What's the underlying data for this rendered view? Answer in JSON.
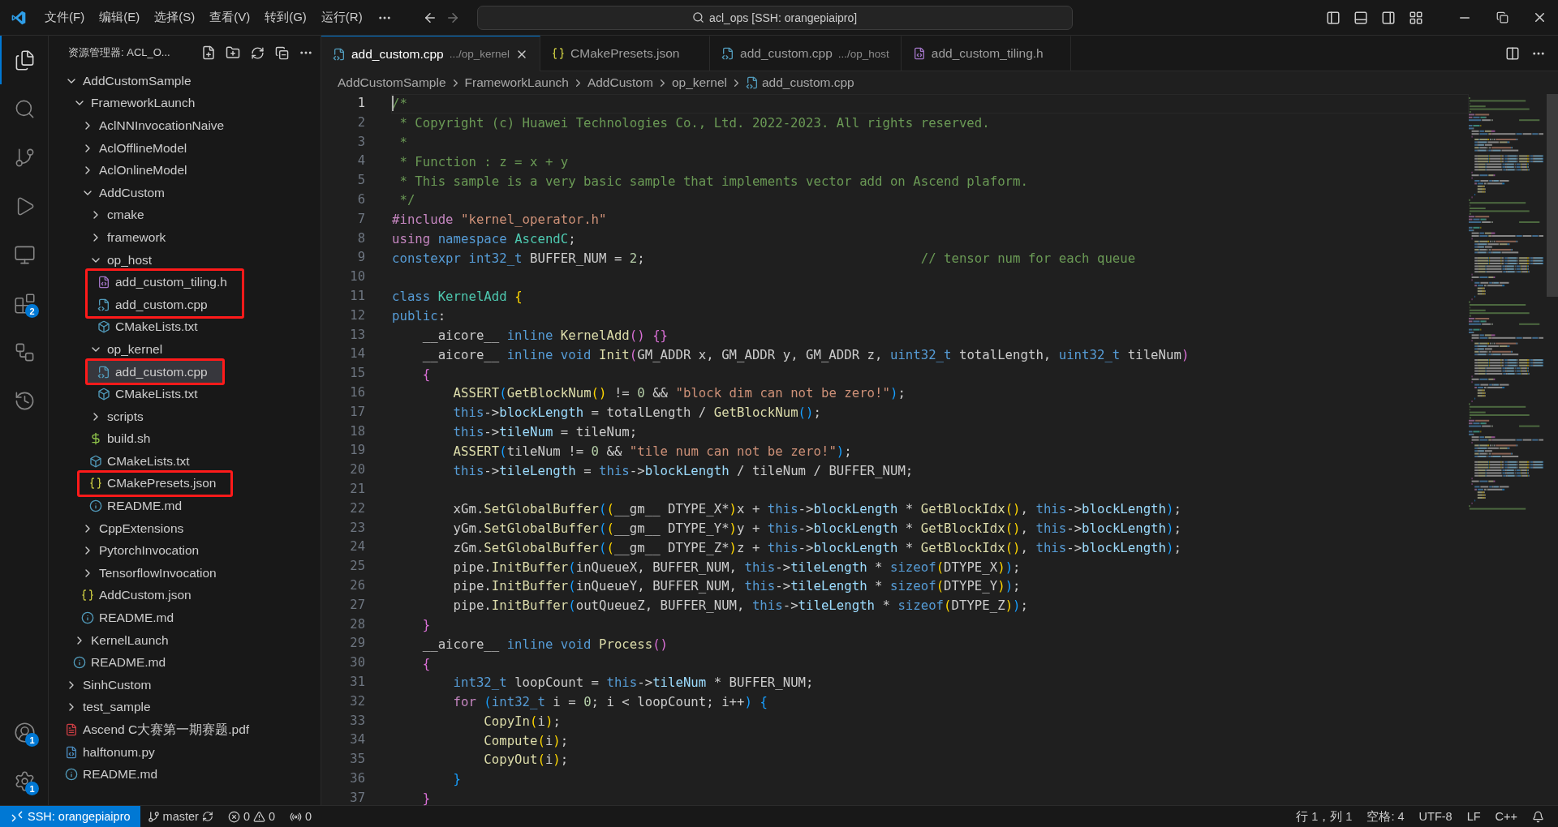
{
  "title_bar": {
    "menus": [
      "文件(F)",
      "编辑(E)",
      "选择(S)",
      "查看(V)",
      "转到(G)",
      "运行(R)"
    ],
    "command_center": "acl_ops [SSH: orangepiaipro]"
  },
  "activity_bar": {
    "top": [
      {
        "kind": "explorer",
        "selected": true
      },
      {
        "kind": "search",
        "selected": false
      },
      {
        "kind": "source_control",
        "selected": false
      },
      {
        "kind": "run",
        "selected": false
      },
      {
        "kind": "remote",
        "selected": false
      },
      {
        "kind": "extensions",
        "selected": false,
        "badge": "2"
      },
      {
        "kind": "graph",
        "selected": false
      },
      {
        "kind": "timeline",
        "selected": false
      }
    ],
    "bottom": [
      {
        "kind": "accounts",
        "selected": false,
        "badge": "1"
      },
      {
        "kind": "settings",
        "selected": false,
        "badge": "1"
      }
    ]
  },
  "explorer": {
    "title": "资源管理器: ACL_O...",
    "tree": [
      {
        "label": "AddCustomSample",
        "kind": "folder",
        "expanded": true,
        "selected": false,
        "marked": false,
        "children": [
          {
            "label": "FrameworkLaunch",
            "kind": "folder",
            "expanded": true,
            "selected": false,
            "marked": false,
            "children": [
              {
                "label": "AclNNInvocationNaive",
                "kind": "folder",
                "expanded": false,
                "selected": false,
                "marked": false
              },
              {
                "label": "AclOfflineModel",
                "kind": "folder",
                "expanded": false,
                "selected": false,
                "marked": false
              },
              {
                "label": "AclOnlineModel",
                "kind": "folder",
                "expanded": false,
                "selected": false,
                "marked": false
              },
              {
                "label": "AddCustom",
                "kind": "folder",
                "expanded": true,
                "selected": false,
                "marked": false,
                "children": [
                  {
                    "label": "cmake",
                    "kind": "folder",
                    "expanded": false,
                    "selected": false,
                    "marked": false
                  },
                  {
                    "label": "framework",
                    "kind": "folder",
                    "expanded": false,
                    "selected": false,
                    "marked": false
                  },
                  {
                    "label": "op_host",
                    "kind": "folder",
                    "expanded": true,
                    "selected": false,
                    "marked": false,
                    "children": [
                      {
                        "label": "add_custom_tiling.h",
                        "kind": "c_header",
                        "selected": false,
                        "marked": true
                      },
                      {
                        "label": "add_custom.cpp",
                        "kind": "cpp",
                        "selected": false,
                        "marked": true
                      },
                      {
                        "label": "CMakeLists.txt",
                        "kind": "cmake",
                        "selected": false,
                        "marked": false
                      }
                    ]
                  },
                  {
                    "label": "op_kernel",
                    "kind": "folder",
                    "expanded": true,
                    "selected": false,
                    "marked": false,
                    "children": [
                      {
                        "label": "add_custom.cpp",
                        "kind": "cpp",
                        "selected": true,
                        "marked": true
                      },
                      {
                        "label": "CMakeLists.txt",
                        "kind": "cmake",
                        "selected": false,
                        "marked": false
                      }
                    ]
                  },
                  {
                    "label": "scripts",
                    "kind": "folder",
                    "expanded": false,
                    "selected": false,
                    "marked": false
                  },
                  {
                    "label": "build.sh",
                    "kind": "shell",
                    "selected": false,
                    "marked": false
                  },
                  {
                    "label": "CMakeLists.txt",
                    "kind": "cmake",
                    "selected": false,
                    "marked": false
                  },
                  {
                    "label": "CMakePresets.json",
                    "kind": "json",
                    "selected": false,
                    "marked": true
                  },
                  {
                    "label": "README.md",
                    "kind": "markdown",
                    "selected": false,
                    "marked": false
                  }
                ]
              },
              {
                "label": "CppExtensions",
                "kind": "folder",
                "expanded": false,
                "selected": false,
                "marked": false
              },
              {
                "label": "PytorchInvocation",
                "kind": "folder",
                "expanded": false,
                "selected": false,
                "marked": false
              },
              {
                "label": "TensorflowInvocation",
                "kind": "folder",
                "expanded": false,
                "selected": false,
                "marked": false
              },
              {
                "label": "AddCustom.json",
                "kind": "json",
                "selected": false,
                "marked": false
              },
              {
                "label": "README.md",
                "kind": "markdown",
                "selected": false,
                "marked": false
              }
            ]
          },
          {
            "label": "KernelLaunch",
            "kind": "folder",
            "expanded": false,
            "selected": false,
            "marked": false
          },
          {
            "label": "README.md",
            "kind": "markdown",
            "selected": false,
            "marked": false
          }
        ]
      },
      {
        "label": "SinhCustom",
        "kind": "folder",
        "expanded": false,
        "selected": false,
        "marked": false
      },
      {
        "label": "test_sample",
        "kind": "folder",
        "expanded": false,
        "selected": false,
        "marked": false
      },
      {
        "label": "Ascend C大赛第一期赛题.pdf",
        "kind": "pdf",
        "selected": false,
        "marked": false
      },
      {
        "label": "halftonum.py",
        "kind": "python",
        "selected": false,
        "marked": false
      },
      {
        "label": "README.md",
        "kind": "markdown",
        "selected": false,
        "marked": false
      }
    ]
  },
  "tabs": [
    {
      "label": "add_custom.cpp",
      "description": ".../op_kernel",
      "kind": "cpp",
      "selected": true
    },
    {
      "label": "CMakePresets.json",
      "kind": "json",
      "selected": false
    },
    {
      "label": "add_custom.cpp",
      "description": ".../op_host",
      "kind": "cpp",
      "selected": false
    },
    {
      "label": "add_custom_tiling.h",
      "kind": "c_header",
      "selected": false
    }
  ],
  "breadcrumb": [
    {
      "label": "AddCustomSample",
      "kind": "folder"
    },
    {
      "label": "FrameworkLaunch",
      "kind": "folder"
    },
    {
      "label": "AddCustom",
      "kind": "folder"
    },
    {
      "label": "op_kernel",
      "kind": "folder"
    },
    {
      "label": "add_custom.cpp",
      "kind": "cpp"
    }
  ],
  "code": [
    {
      "n": "1",
      "current": true,
      "tokens": [
        {
          "kind": "c",
          "text": "/*"
        }
      ]
    },
    {
      "n": "2",
      "current": false,
      "tokens": [
        {
          "kind": "c",
          "text": " * Copyright (c) Huawei Technologies Co., Ltd. 2022-2023. All rights reserved."
        }
      ]
    },
    {
      "n": "3",
      "current": false,
      "tokens": [
        {
          "kind": "c",
          "text": " *"
        }
      ]
    },
    {
      "n": "4",
      "current": false,
      "tokens": [
        {
          "kind": "c",
          "text": " * Function : z = x + y"
        }
      ]
    },
    {
      "n": "5",
      "current": false,
      "tokens": [
        {
          "kind": "c",
          "text": " * This sample is a very basic sample that implements vector add on Ascend plaform."
        }
      ]
    },
    {
      "n": "6",
      "current": false,
      "tokens": [
        {
          "kind": "c",
          "text": " */"
        }
      ]
    },
    {
      "n": "7",
      "current": false,
      "tokens": [
        {
          "kind": "pp",
          "text": "#include "
        },
        {
          "kind": "s",
          "text": "\"kernel_operator.h\""
        }
      ]
    },
    {
      "n": "8",
      "current": false,
      "tokens": [
        {
          "kind": "pp",
          "text": "using "
        },
        {
          "kind": "kw",
          "text": "namespace "
        },
        {
          "kind": "ty",
          "text": "AscendC"
        },
        {
          "kind": "p",
          "text": ";"
        }
      ]
    },
    {
      "n": "9",
      "current": false,
      "tokens": [
        {
          "kind": "kw",
          "text": "constexpr int32_t "
        },
        {
          "kind": "p",
          "text": "BUFFER_NUM = "
        },
        {
          "kind": "n",
          "text": "2"
        },
        {
          "kind": "p",
          "text": ";                                    "
        },
        {
          "kind": "c",
          "text": "// tensor num for each queue"
        }
      ]
    },
    {
      "n": "10",
      "current": false
    },
    {
      "n": "11",
      "current": false,
      "tokens": [
        {
          "kind": "kw",
          "text": "class "
        },
        {
          "kind": "ty",
          "text": "KernelAdd "
        },
        {
          "kind": "b1",
          "text": "{"
        }
      ]
    },
    {
      "n": "12",
      "current": false,
      "tokens": [
        {
          "kind": "kw",
          "text": "public"
        },
        {
          "kind": "p",
          "text": ":"
        }
      ]
    },
    {
      "n": "13",
      "current": false,
      "tokens": [
        {
          "kind": "p",
          "text": "    __aicore__ "
        },
        {
          "kind": "kw",
          "text": "inline "
        },
        {
          "kind": "fn",
          "text": "KernelAdd"
        },
        {
          "kind": "b2",
          "text": "() {}"
        }
      ]
    },
    {
      "n": "14",
      "current": false,
      "tokens": [
        {
          "kind": "p",
          "text": "    __aicore__ "
        },
        {
          "kind": "kw",
          "text": "inline void "
        },
        {
          "kind": "fn",
          "text": "Init"
        },
        {
          "kind": "b2",
          "text": "("
        },
        {
          "kind": "p",
          "text": "GM_ADDR x, GM_ADDR y, GM_ADDR z, "
        },
        {
          "kind": "kw",
          "text": "uint32_t "
        },
        {
          "kind": "p",
          "text": "totalLength, "
        },
        {
          "kind": "kw",
          "text": "uint32_t "
        },
        {
          "kind": "p",
          "text": "tileNum"
        },
        {
          "kind": "b2",
          "text": ")"
        }
      ]
    },
    {
      "n": "15",
      "current": false,
      "tokens": [
        {
          "kind": "b2",
          "text": "    {"
        }
      ]
    },
    {
      "n": "16",
      "current": false,
      "tokens": [
        {
          "kind": "fn",
          "text": "        ASSERT"
        },
        {
          "kind": "b3",
          "text": "("
        },
        {
          "kind": "fn",
          "text": "GetBlockNum"
        },
        {
          "kind": "b1",
          "text": "()"
        },
        {
          "kind": "p",
          "text": " != "
        },
        {
          "kind": "n",
          "text": "0"
        },
        {
          "kind": "p",
          "text": " && "
        },
        {
          "kind": "s",
          "text": "\"block dim can not be zero!\""
        },
        {
          "kind": "b3",
          "text": ")"
        },
        {
          "kind": "p",
          "text": ";"
        }
      ]
    },
    {
      "n": "17",
      "current": false,
      "tokens": [
        {
          "kind": "kw",
          "text": "        this"
        },
        {
          "kind": "p",
          "text": "->"
        },
        {
          "kind": "v",
          "text": "blockLength"
        },
        {
          "kind": "p",
          "text": " = totalLength / "
        },
        {
          "kind": "fn",
          "text": "GetBlockNum"
        },
        {
          "kind": "b3",
          "text": "()"
        },
        {
          "kind": "p",
          "text": ";"
        }
      ]
    },
    {
      "n": "18",
      "current": false,
      "tokens": [
        {
          "kind": "kw",
          "text": "        this"
        },
        {
          "kind": "p",
          "text": "->"
        },
        {
          "kind": "v",
          "text": "tileNum"
        },
        {
          "kind": "p",
          "text": " = tileNum;"
        }
      ]
    },
    {
      "n": "19",
      "current": false,
      "tokens": [
        {
          "kind": "fn",
          "text": "        ASSERT"
        },
        {
          "kind": "b3",
          "text": "("
        },
        {
          "kind": "p",
          "text": "tileNum != "
        },
        {
          "kind": "n",
          "text": "0"
        },
        {
          "kind": "p",
          "text": " && "
        },
        {
          "kind": "s",
          "text": "\"tile num can not be zero!\""
        },
        {
          "kind": "b3",
          "text": ")"
        },
        {
          "kind": "p",
          "text": ";"
        }
      ]
    },
    {
      "n": "20",
      "current": false,
      "tokens": [
        {
          "kind": "kw",
          "text": "        this"
        },
        {
          "kind": "p",
          "text": "->"
        },
        {
          "kind": "v",
          "text": "tileLength"
        },
        {
          "kind": "p",
          "text": " = "
        },
        {
          "kind": "kw",
          "text": "this"
        },
        {
          "kind": "p",
          "text": "->"
        },
        {
          "kind": "v",
          "text": "blockLength"
        },
        {
          "kind": "p",
          "text": " / tileNum / BUFFER_NUM;"
        }
      ]
    },
    {
      "n": "21",
      "current": false
    },
    {
      "n": "22",
      "current": false,
      "tokens": [
        {
          "kind": "p",
          "text": "        xGm."
        },
        {
          "kind": "fn",
          "text": "SetGlobalBuffer"
        },
        {
          "kind": "b3",
          "text": "("
        },
        {
          "kind": "b1",
          "text": "("
        },
        {
          "kind": "p",
          "text": "__gm__ DTYPE_X*"
        },
        {
          "kind": "b1",
          "text": ")"
        },
        {
          "kind": "p",
          "text": "x + "
        },
        {
          "kind": "kw",
          "text": "this"
        },
        {
          "kind": "p",
          "text": "->"
        },
        {
          "kind": "v",
          "text": "blockLength"
        },
        {
          "kind": "p",
          "text": " * "
        },
        {
          "kind": "fn",
          "text": "GetBlockIdx"
        },
        {
          "kind": "b1",
          "text": "()"
        },
        {
          "kind": "p",
          "text": ", "
        },
        {
          "kind": "kw",
          "text": "this"
        },
        {
          "kind": "p",
          "text": "->"
        },
        {
          "kind": "v",
          "text": "blockLength"
        },
        {
          "kind": "b3",
          "text": ")"
        },
        {
          "kind": "p",
          "text": ";"
        }
      ]
    },
    {
      "n": "23",
      "current": false,
      "tokens": [
        {
          "kind": "p",
          "text": "        yGm."
        },
        {
          "kind": "fn",
          "text": "SetGlobalBuffer"
        },
        {
          "kind": "b3",
          "text": "("
        },
        {
          "kind": "b1",
          "text": "("
        },
        {
          "kind": "p",
          "text": "__gm__ DTYPE_Y*"
        },
        {
          "kind": "b1",
          "text": ")"
        },
        {
          "kind": "p",
          "text": "y + "
        },
        {
          "kind": "kw",
          "text": "this"
        },
        {
          "kind": "p",
          "text": "->"
        },
        {
          "kind": "v",
          "text": "blockLength"
        },
        {
          "kind": "p",
          "text": " * "
        },
        {
          "kind": "fn",
          "text": "GetBlockIdx"
        },
        {
          "kind": "b1",
          "text": "()"
        },
        {
          "kind": "p",
          "text": ", "
        },
        {
          "kind": "kw",
          "text": "this"
        },
        {
          "kind": "p",
          "text": "->"
        },
        {
          "kind": "v",
          "text": "blockLength"
        },
        {
          "kind": "b3",
          "text": ")"
        },
        {
          "kind": "p",
          "text": ";"
        }
      ]
    },
    {
      "n": "24",
      "current": false,
      "tokens": [
        {
          "kind": "p",
          "text": "        zGm."
        },
        {
          "kind": "fn",
          "text": "SetGlobalBuffer"
        },
        {
          "kind": "b3",
          "text": "("
        },
        {
          "kind": "b1",
          "text": "("
        },
        {
          "kind": "p",
          "text": "__gm__ DTYPE_Z*"
        },
        {
          "kind": "b1",
          "text": ")"
        },
        {
          "kind": "p",
          "text": "z + "
        },
        {
          "kind": "kw",
          "text": "this"
        },
        {
          "kind": "p",
          "text": "->"
        },
        {
          "kind": "v",
          "text": "blockLength"
        },
        {
          "kind": "p",
          "text": " * "
        },
        {
          "kind": "fn",
          "text": "GetBlockIdx"
        },
        {
          "kind": "b1",
          "text": "()"
        },
        {
          "kind": "p",
          "text": ", "
        },
        {
          "kind": "kw",
          "text": "this"
        },
        {
          "kind": "p",
          "text": "->"
        },
        {
          "kind": "v",
          "text": "blockLength"
        },
        {
          "kind": "b3",
          "text": ")"
        },
        {
          "kind": "p",
          "text": ";"
        }
      ]
    },
    {
      "n": "25",
      "current": false,
      "tokens": [
        {
          "kind": "p",
          "text": "        pipe."
        },
        {
          "kind": "fn",
          "text": "InitBuffer"
        },
        {
          "kind": "b3",
          "text": "("
        },
        {
          "kind": "p",
          "text": "inQueueX, BUFFER_NUM, "
        },
        {
          "kind": "kw",
          "text": "this"
        },
        {
          "kind": "p",
          "text": "->"
        },
        {
          "kind": "v",
          "text": "tileLength"
        },
        {
          "kind": "p",
          "text": " * "
        },
        {
          "kind": "kw",
          "text": "sizeof"
        },
        {
          "kind": "b1",
          "text": "("
        },
        {
          "kind": "p",
          "text": "DTYPE_X"
        },
        {
          "kind": "b1",
          "text": ")"
        },
        {
          "kind": "b3",
          "text": ")"
        },
        {
          "kind": "p",
          "text": ";"
        }
      ]
    },
    {
      "n": "26",
      "current": false,
      "tokens": [
        {
          "kind": "p",
          "text": "        pipe."
        },
        {
          "kind": "fn",
          "text": "InitBuffer"
        },
        {
          "kind": "b3",
          "text": "("
        },
        {
          "kind": "p",
          "text": "inQueueY, BUFFER_NUM, "
        },
        {
          "kind": "kw",
          "text": "this"
        },
        {
          "kind": "p",
          "text": "->"
        },
        {
          "kind": "v",
          "text": "tileLength"
        },
        {
          "kind": "p",
          "text": " * "
        },
        {
          "kind": "kw",
          "text": "sizeof"
        },
        {
          "kind": "b1",
          "text": "("
        },
        {
          "kind": "p",
          "text": "DTYPE_Y"
        },
        {
          "kind": "b1",
          "text": ")"
        },
        {
          "kind": "b3",
          "text": ")"
        },
        {
          "kind": "p",
          "text": ";"
        }
      ]
    },
    {
      "n": "27",
      "current": false,
      "tokens": [
        {
          "kind": "p",
          "text": "        pipe."
        },
        {
          "kind": "fn",
          "text": "InitBuffer"
        },
        {
          "kind": "b3",
          "text": "("
        },
        {
          "kind": "p",
          "text": "outQueueZ, BUFFER_NUM, "
        },
        {
          "kind": "kw",
          "text": "this"
        },
        {
          "kind": "p",
          "text": "->"
        },
        {
          "kind": "v",
          "text": "tileLength"
        },
        {
          "kind": "p",
          "text": " * "
        },
        {
          "kind": "kw",
          "text": "sizeof"
        },
        {
          "kind": "b1",
          "text": "("
        },
        {
          "kind": "p",
          "text": "DTYPE_Z"
        },
        {
          "kind": "b1",
          "text": ")"
        },
        {
          "kind": "b3",
          "text": ")"
        },
        {
          "kind": "p",
          "text": ";"
        }
      ]
    },
    {
      "n": "28",
      "current": false,
      "tokens": [
        {
          "kind": "b2",
          "text": "    }"
        }
      ]
    },
    {
      "n": "29",
      "current": false,
      "tokens": [
        {
          "kind": "p",
          "text": "    __aicore__ "
        },
        {
          "kind": "kw",
          "text": "inline void "
        },
        {
          "kind": "fn",
          "text": "Process"
        },
        {
          "kind": "b2",
          "text": "()"
        }
      ]
    },
    {
      "n": "30",
      "current": false,
      "tokens": [
        {
          "kind": "b2",
          "text": "    {"
        }
      ]
    },
    {
      "n": "31",
      "current": false,
      "tokens": [
        {
          "kind": "kw",
          "text": "        int32_t "
        },
        {
          "kind": "p",
          "text": "loopCount = "
        },
        {
          "kind": "kw",
          "text": "this"
        },
        {
          "kind": "p",
          "text": "->"
        },
        {
          "kind": "v",
          "text": "tileNum"
        },
        {
          "kind": "p",
          "text": " * BUFFER_NUM;"
        }
      ]
    },
    {
      "n": "32",
      "current": false,
      "tokens": [
        {
          "kind": "pp",
          "text": "        for "
        },
        {
          "kind": "b3",
          "text": "("
        },
        {
          "kind": "kw",
          "text": "int32_t "
        },
        {
          "kind": "p",
          "text": "i = "
        },
        {
          "kind": "n",
          "text": "0"
        },
        {
          "kind": "p",
          "text": "; i < loopCount; i++"
        },
        {
          "kind": "b3",
          "text": ") {"
        }
      ]
    },
    {
      "n": "33",
      "current": false,
      "tokens": [
        {
          "kind": "fn",
          "text": "            CopyIn"
        },
        {
          "kind": "b1",
          "text": "("
        },
        {
          "kind": "p",
          "text": "i"
        },
        {
          "kind": "b1",
          "text": ")"
        },
        {
          "kind": "p",
          "text": ";"
        }
      ]
    },
    {
      "n": "34",
      "current": false,
      "tokens": [
        {
          "kind": "fn",
          "text": "            Compute"
        },
        {
          "kind": "b1",
          "text": "("
        },
        {
          "kind": "p",
          "text": "i"
        },
        {
          "kind": "b1",
          "text": ")"
        },
        {
          "kind": "p",
          "text": ";"
        }
      ]
    },
    {
      "n": "35",
      "current": false,
      "tokens": [
        {
          "kind": "fn",
          "text": "            CopyOut"
        },
        {
          "kind": "b1",
          "text": "("
        },
        {
          "kind": "p",
          "text": "i"
        },
        {
          "kind": "b1",
          "text": ")"
        },
        {
          "kind": "p",
          "text": ";"
        }
      ]
    },
    {
      "n": "36",
      "current": false,
      "tokens": [
        {
          "kind": "b3",
          "text": "        }"
        }
      ]
    },
    {
      "n": "37",
      "current": false,
      "tokens": [
        {
          "kind": "b2",
          "text": "    }"
        }
      ]
    }
  ],
  "status_bar": {
    "remote": "SSH: orangepiaipro",
    "branch": "master",
    "errors": "0",
    "warnings": "0",
    "ports": "0",
    "right": [
      {
        "kind": "text",
        "label": "行 1，列 1"
      },
      {
        "kind": "text",
        "label": "空格: 4"
      },
      {
        "kind": "text",
        "label": "UTF-8"
      },
      {
        "kind": "text",
        "label": "LF"
      },
      {
        "kind": "text",
        "label": "C++"
      },
      {
        "kind": "bell"
      }
    ]
  }
}
